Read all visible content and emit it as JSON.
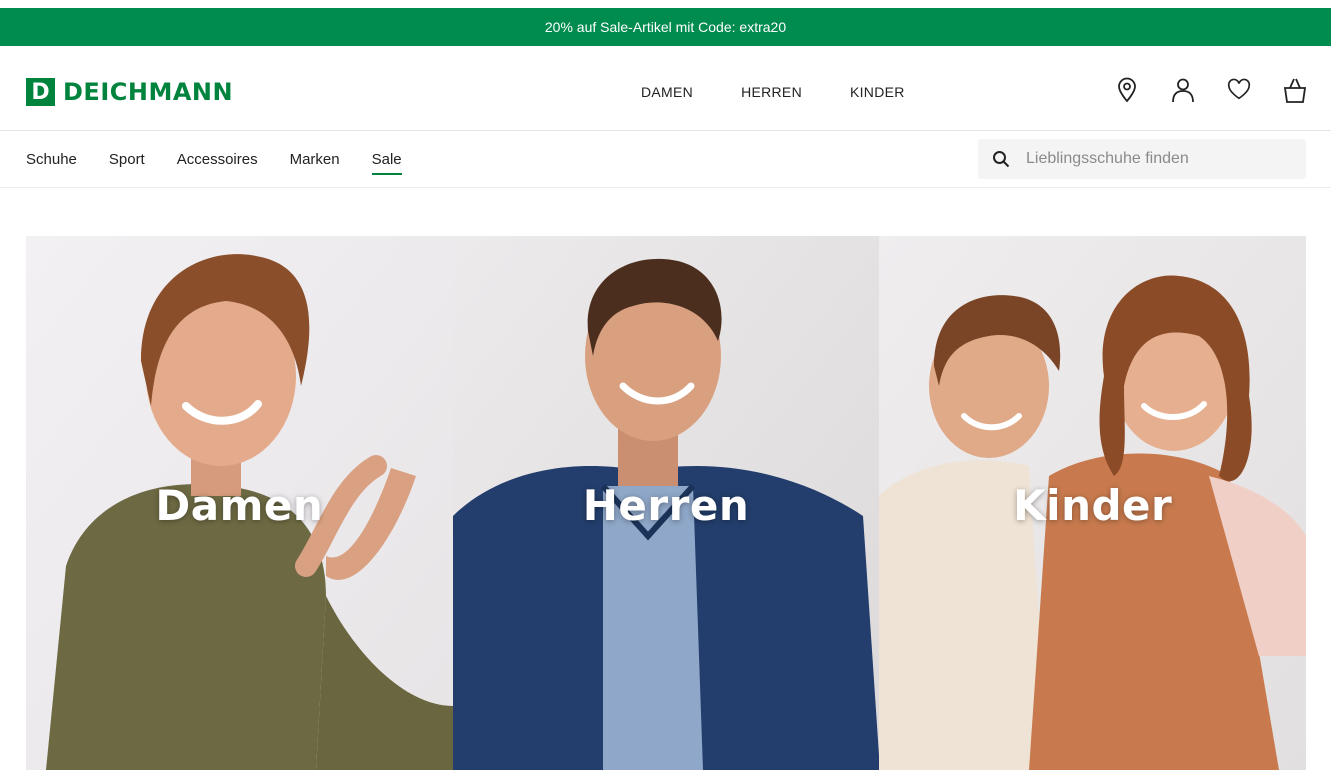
{
  "promo": {
    "text": "20% auf Sale-Artikel mit Code: extra20"
  },
  "brand": {
    "logo_letter": "D",
    "logo_text": "DEICHMANN",
    "color": "#00843d"
  },
  "main_nav": [
    "DAMEN",
    "HERREN",
    "KINDER"
  ],
  "header_icons": [
    "location-icon",
    "account-icon",
    "wishlist-heart-icon",
    "shopping-bag-icon"
  ],
  "sub_nav": {
    "items": [
      "Schuhe",
      "Sport",
      "Accessoires",
      "Marken",
      "Sale"
    ],
    "active": "Sale"
  },
  "search": {
    "placeholder": "Lieblingsschuhe finden"
  },
  "hero_tiles": [
    {
      "label": "Damen"
    },
    {
      "label": "Herren"
    },
    {
      "label": "Kinder"
    }
  ],
  "colors": {
    "promo_bar": "#008b4f",
    "accent": "#00843d"
  }
}
